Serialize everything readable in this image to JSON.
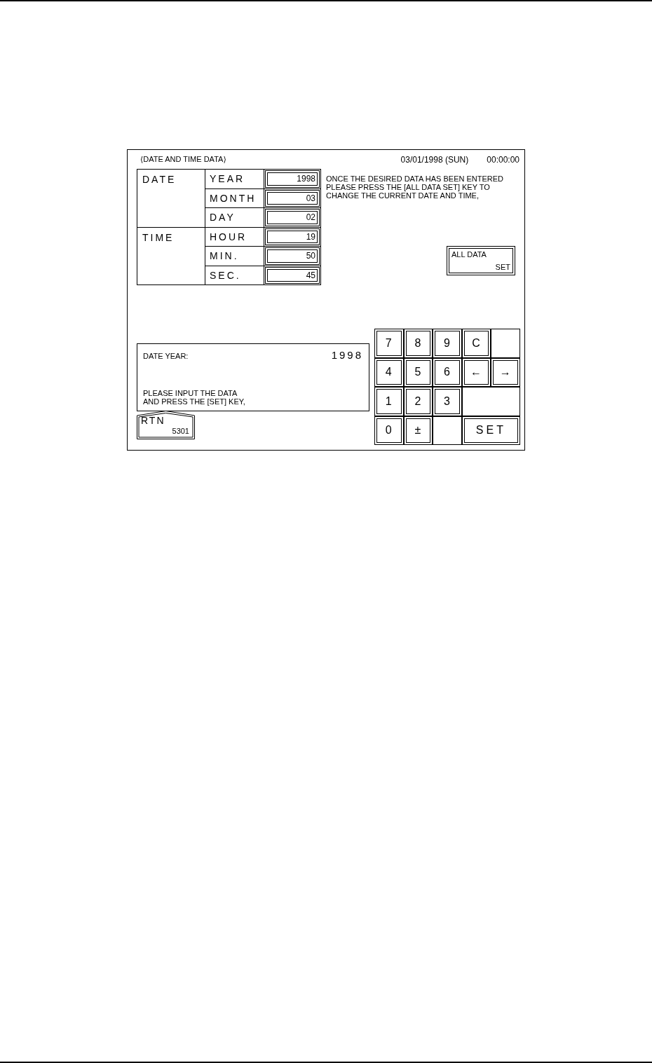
{
  "screen": {
    "title": "⟨DATE AND TIME DATA⟩",
    "date": "03/01/1998 (SUN)",
    "time": "00:00:00"
  },
  "settings": {
    "groups": [
      {
        "name": "DATE",
        "fields": [
          {
            "label": "YEAR",
            "value": "1998"
          },
          {
            "label": "MONTH",
            "value": "03"
          },
          {
            "label": "DAY",
            "value": "02"
          }
        ]
      },
      {
        "name": "TIME",
        "fields": [
          {
            "label": "HOUR",
            "value": "19"
          },
          {
            "label": "MIN.",
            "value": "50"
          },
          {
            "label": "SEC.",
            "value": "45"
          }
        ]
      }
    ]
  },
  "message": "ONCE THE DESIRED DATA HAS BEEN ENTERED\nPLEASE PRESS THE [ALL DATA SET] KEY TO\nCHANGE THE CURRENT DATE AND TIME,",
  "all_data_set_button": {
    "label_lines": [
      "ALL DATA",
      "SET"
    ]
  },
  "entry": {
    "label": "DATE YEAR:",
    "value": "1998",
    "prompt": "PLEASE INPUT THE DATA\nAND PRESS THE [SET] KEY,"
  },
  "return_button": {
    "label": "RTN",
    "code": "5301"
  },
  "keypad": [
    [
      {
        "kind": "key",
        "label": "7"
      },
      {
        "kind": "key",
        "label": "8"
      },
      {
        "kind": "key",
        "label": "9"
      },
      {
        "kind": "key",
        "label": "C"
      },
      {
        "kind": "blank"
      }
    ],
    [
      {
        "kind": "key",
        "label": "4"
      },
      {
        "kind": "key",
        "label": "5"
      },
      {
        "kind": "key",
        "label": "6"
      },
      {
        "kind": "key",
        "label": "←"
      },
      {
        "kind": "key",
        "label": "→"
      }
    ],
    [
      {
        "kind": "key",
        "label": "1"
      },
      {
        "kind": "key",
        "label": "2"
      },
      {
        "kind": "key",
        "label": "3"
      },
      {
        "kind": "wide-blank"
      }
    ],
    [
      {
        "kind": "key",
        "label": "0"
      },
      {
        "kind": "key",
        "label": "±"
      },
      {
        "kind": "blank"
      },
      {
        "kind": "wide-key",
        "label": "SET"
      }
    ]
  ]
}
